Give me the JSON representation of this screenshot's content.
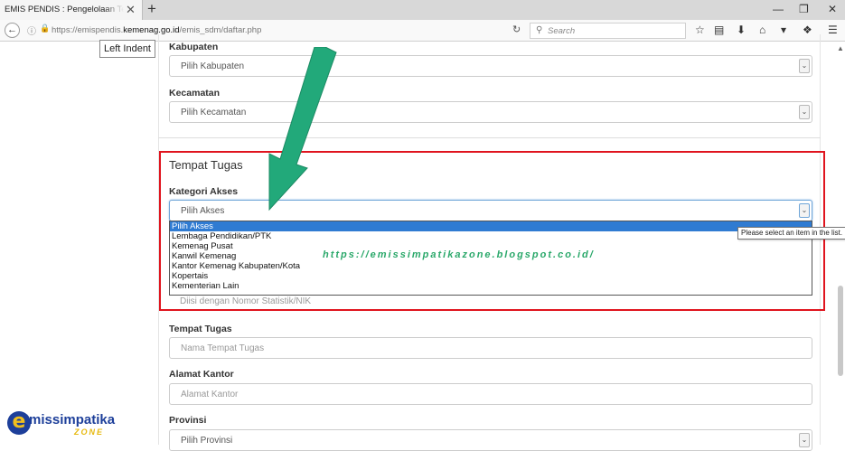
{
  "browser": {
    "tab_title": "EMIS PENDIS : Pengelolaan Tenaga",
    "tab_close": "✕",
    "new_tab": "+",
    "url_prefix": "https://emispendis.",
    "url_domain": "kemenag.go.id",
    "url_path": "/emis_sdm/daftar.php",
    "search_placeholder": "Search",
    "window_controls": [
      "—",
      "❐",
      "✕"
    ]
  },
  "tooltips": {
    "left_indent": "Left Indent",
    "validation": "Please select an item in the list."
  },
  "form": {
    "kabupaten": {
      "label": "Kabupaten",
      "value": "Pilih Kabupaten"
    },
    "kecamatan": {
      "label": "Kecamatan",
      "value": "Pilih Kecamatan"
    },
    "section_title": "Tempat Tugas",
    "kategori_akses": {
      "label": "Kategori Akses",
      "value": "Pilih Akses",
      "options": [
        "Pilih Akses",
        "Lembaga Pendidikan/PTK",
        "Kemenag Pusat",
        "Kanwil Kemenag",
        "Kantor Kemenag Kabupaten/Kota",
        "Kopertais",
        "Kementerian Lain"
      ]
    },
    "nik_placeholder": "Diisi dengan Nomor Statistik/NIK",
    "tempat_tugas": {
      "label": "Tempat Tugas",
      "placeholder": "Nama Tempat Tugas"
    },
    "alamat_kantor": {
      "label": "Alamat Kantor",
      "placeholder": "Alamat Kantor"
    },
    "provinsi": {
      "label": "Provinsi",
      "value": "Pilih Provinsi"
    }
  },
  "overlay": {
    "watermark": "https://emissimpatikazone.blogspot.co.id/",
    "logo_text": "missimpatika",
    "logo_initial": "e",
    "logo_sub": "ZONE"
  },
  "colors": {
    "highlight_box": "#e0141e",
    "arrow": "#22a97a",
    "selected_option": "#2f7bd2"
  }
}
